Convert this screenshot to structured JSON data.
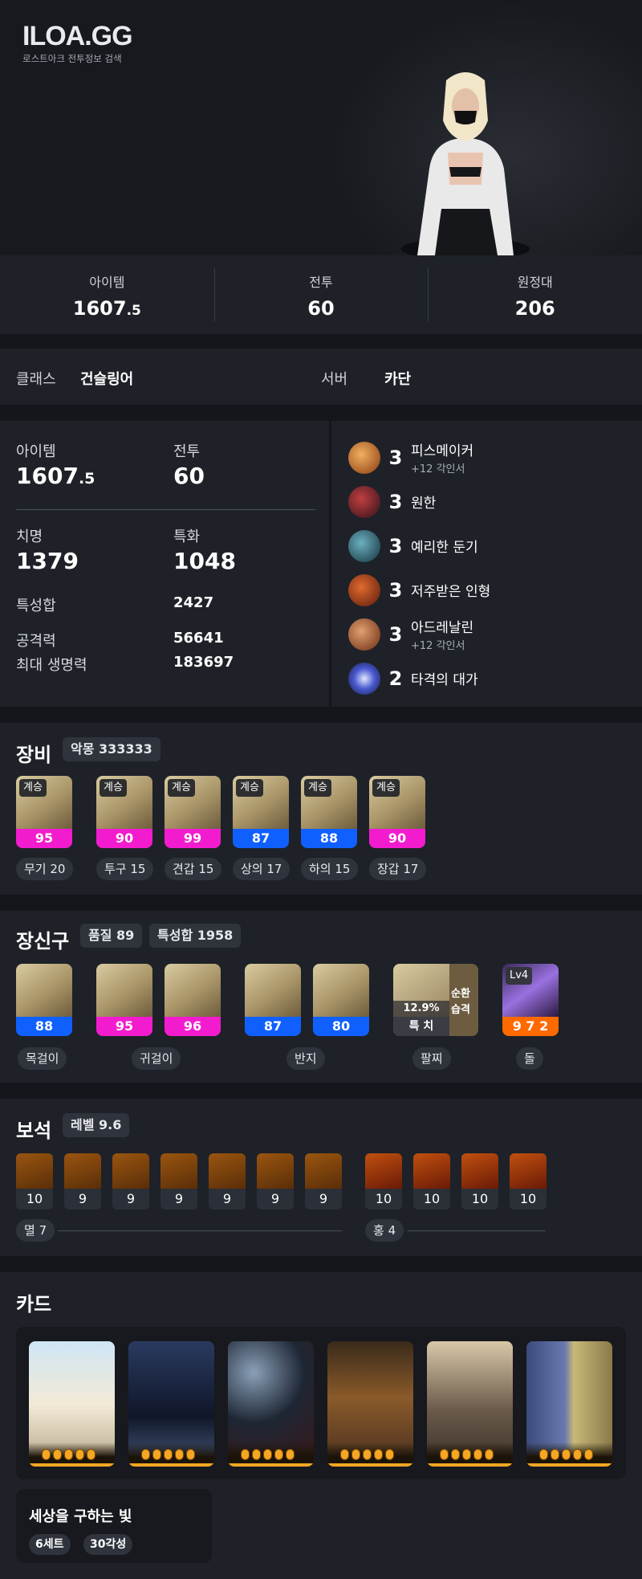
{
  "brand": {
    "logo": "ILOA.GG",
    "subtitle": "로스트아크 전투정보 검색"
  },
  "summary": [
    {
      "label": "아이템",
      "value": "1607",
      "decimal": ".5"
    },
    {
      "label": "전투",
      "value": "60"
    },
    {
      "label": "원정대",
      "value": "206"
    }
  ],
  "profile": {
    "class_label": "클래스",
    "class_value": "건슬링어",
    "server_label": "서버",
    "server_value": "카단"
  },
  "stats": {
    "item_label": "아이템",
    "item_value": "1607",
    "item_decimal": ".5",
    "combat_label": "전투",
    "combat_value": "60",
    "crit_label": "치명",
    "crit_value": "1379",
    "spec_label": "특화",
    "spec_value": "1048",
    "stat_sum_label": "특성합",
    "stat_sum_value": "2427",
    "attack_label": "공격력",
    "attack_value": "56641",
    "hp_label": "최대 생명력",
    "hp_value": "183697"
  },
  "engravings": [
    {
      "level": "3",
      "name": "피스메이커",
      "sub": "+12 각인서",
      "icon": "peacemaker-engraving-icon",
      "color": "#c8742a"
    },
    {
      "level": "3",
      "name": "원한",
      "sub": "",
      "icon": "grudge-engraving-icon",
      "color": "#8a2a2a"
    },
    {
      "level": "3",
      "name": "예리한 둔기",
      "sub": "",
      "icon": "keen-blunt-weapon-engraving-icon",
      "color": "#2a5a6a"
    },
    {
      "level": "3",
      "name": "저주받은 인형",
      "sub": "",
      "icon": "cursed-doll-engraving-icon",
      "color": "#b2421a"
    },
    {
      "level": "3",
      "name": "아드레날린",
      "sub": "+12 각인서",
      "icon": "adrenaline-engraving-icon",
      "color": "#a85a2a"
    },
    {
      "level": "2",
      "name": "타격의 대가",
      "sub": "",
      "icon": "hit-master-engraving-icon",
      "color": "#4a5ad0"
    }
  ],
  "equipment": {
    "title": "장비",
    "set_badge": "악몽 333333",
    "items": [
      {
        "tier": "계승",
        "quality": "95",
        "quality_color": "pink",
        "slot": "무기 20",
        "icon": "shotgun-icon"
      },
      {
        "tier": "계승",
        "quality": "90",
        "quality_color": "pink",
        "slot": "투구 15",
        "icon": "hat-icon"
      },
      {
        "tier": "계승",
        "quality": "99",
        "quality_color": "pink",
        "slot": "견갑 15",
        "icon": "shoulder-armor-icon"
      },
      {
        "tier": "계승",
        "quality": "87",
        "quality_color": "blue",
        "slot": "상의 17",
        "icon": "chest-armor-icon"
      },
      {
        "tier": "계승",
        "quality": "88",
        "quality_color": "blue",
        "slot": "하의 15",
        "icon": "leg-armor-icon"
      },
      {
        "tier": "계승",
        "quality": "90",
        "quality_color": "pink",
        "slot": "장갑 17",
        "icon": "gloves-icon"
      }
    ]
  },
  "accessories": {
    "title": "장신구",
    "quality_badge": "품질 89",
    "stat_badge": "특성합 1958",
    "items": [
      {
        "quality": "88",
        "quality_color": "blue",
        "icon": "necklace-icon"
      },
      {
        "quality": "95",
        "quality_color": "pink",
        "icon": "earring-icon"
      },
      {
        "quality": "96",
        "quality_color": "pink",
        "icon": "earring-icon"
      },
      {
        "quality": "87",
        "quality_color": "blue",
        "icon": "ring-icon"
      },
      {
        "quality": "80",
        "quality_color": "blue",
        "icon": "ring-icon"
      }
    ],
    "bracelet": {
      "percent": "12.9%",
      "stat": "특 치",
      "effect_1": "순환",
      "effect_2": "습격",
      "icon": "bracelet-icon"
    },
    "stone": {
      "level": "Lv4",
      "value": "9 7 2",
      "icon": "ability-stone-icon"
    },
    "labels": {
      "necklace": "목걸이",
      "earring": "귀걸이",
      "ring": "반지",
      "bracelet": "팔찌",
      "stone": "돌"
    }
  },
  "gems": {
    "title": "보석",
    "level_badge": "레벨 9.6",
    "annihilation": [
      "10",
      "9",
      "9",
      "9",
      "9",
      "9",
      "9"
    ],
    "crimson": [
      "10",
      "10",
      "10",
      "10"
    ],
    "annihilation_label": "멸 7",
    "crimson_label": "홍 4"
  },
  "cards": {
    "title": "카드",
    "items": [
      {
        "icon": "angel-card-portrait",
        "awakening": 5
      },
      {
        "icon": "dark-knight-card-portrait",
        "awakening": 5
      },
      {
        "icon": "moon-warrior-card-portrait",
        "awakening": 5
      },
      {
        "icon": "golden-armor-card-portrait",
        "awakening": 5
      },
      {
        "icon": "silver-knight-card-portrait",
        "awakening": 5
      },
      {
        "icon": "twin-goddess-card-portrait",
        "awakening": 5
      }
    ],
    "set_name": "세상을 구하는 빛",
    "set_count": "6세트",
    "set_awakening": "30각성"
  }
}
